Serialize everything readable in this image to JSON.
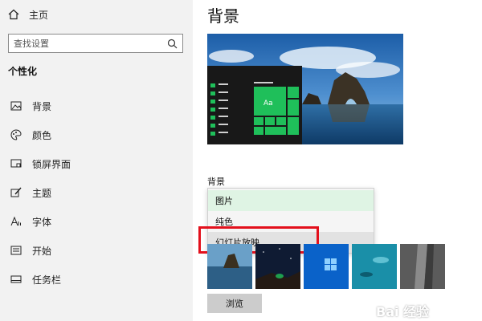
{
  "sidebar": {
    "home_label": "主页",
    "search_placeholder": "查找设置",
    "section_title": "个性化",
    "items": [
      {
        "label": "背景",
        "icon": "picture-icon"
      },
      {
        "label": "颜色",
        "icon": "palette-icon"
      },
      {
        "label": "锁屏界面",
        "icon": "lock-screen-icon"
      },
      {
        "label": "主题",
        "icon": "brush-icon"
      },
      {
        "label": "字体",
        "icon": "font-icon"
      },
      {
        "label": "开始",
        "icon": "start-icon"
      },
      {
        "label": "任务栏",
        "icon": "taskbar-icon"
      }
    ]
  },
  "main": {
    "page_title": "背景",
    "background_label": "背景",
    "preview_tile_text": "Aa",
    "dropdown": {
      "options": [
        "图片",
        "纯色",
        "幻灯片放映"
      ],
      "selected": "图片",
      "highlighted": "幻灯片放映"
    },
    "browse_label": "浏览",
    "thumbnail_count": 5
  },
  "colors": {
    "accent_green": "#1fbf5a",
    "selected_option_bg": "#dff4e4",
    "highlight_red": "#e3101c"
  },
  "watermark": "Bai 经验"
}
